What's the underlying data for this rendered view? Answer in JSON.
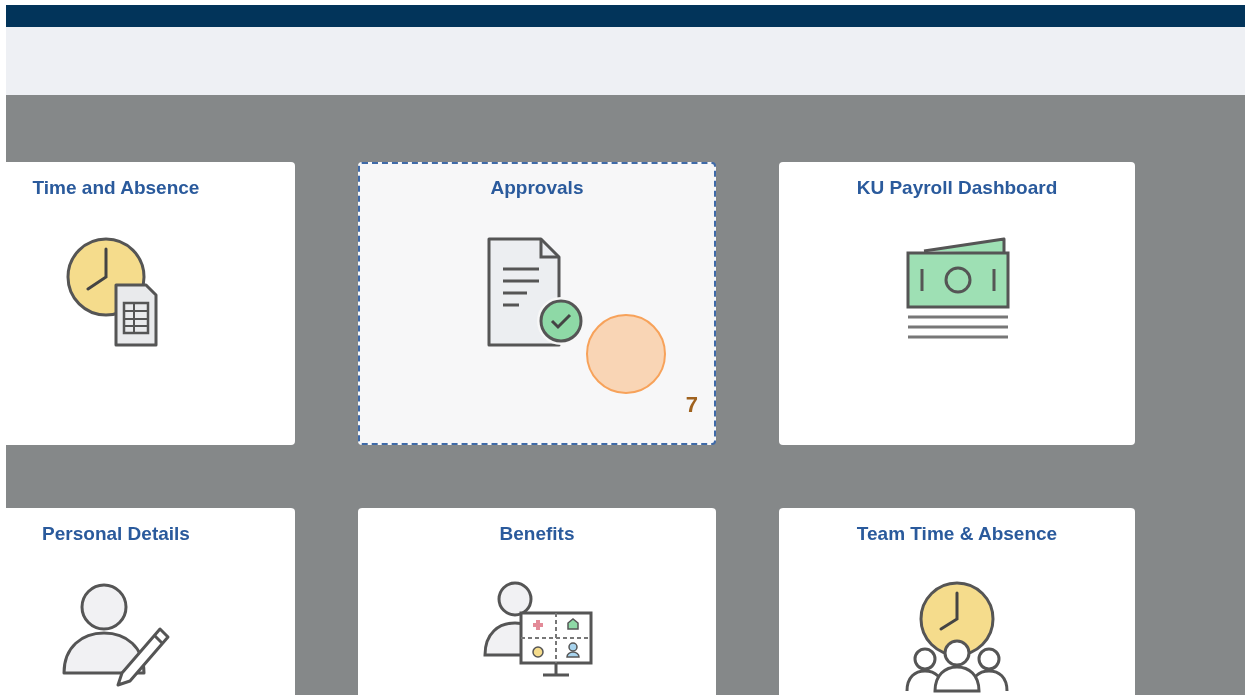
{
  "tiles": [
    {
      "title": "Time and Absence",
      "kind": "clock-sheet",
      "selected": false
    },
    {
      "title": "Approvals",
      "kind": "doc-check",
      "selected": true,
      "badge": "7"
    },
    {
      "title": "KU Payroll Dashboard",
      "kind": "money",
      "selected": false
    },
    {
      "title": "Personal Details",
      "kind": "person-pencil",
      "selected": false
    },
    {
      "title": "Benefits",
      "kind": "person-board",
      "selected": false
    },
    {
      "title": "Team Time & Absence",
      "kind": "team-clock",
      "selected": false
    }
  ]
}
